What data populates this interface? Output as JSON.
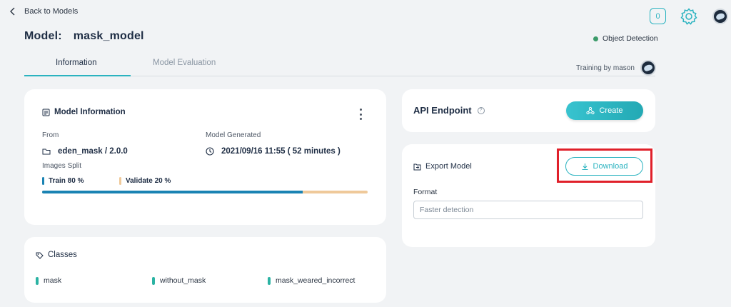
{
  "header": {
    "back_label": "Back to Models",
    "title_prefix": "Model:",
    "model_name": "mask_model",
    "notification_count": "0",
    "status_text": "Object Detection",
    "status_color": "#3c9b6a"
  },
  "tabs": [
    {
      "label": "Information",
      "active": true
    },
    {
      "label": "Model Evaluation",
      "active": false
    }
  ],
  "training_by": "Training by mason",
  "model_info": {
    "title": "Model Information",
    "from_label": "From",
    "from_value": "eden_mask / 2.0.0",
    "generated_label": "Model Generated",
    "generated_value": "2021/09/16 11:55 ( 52 minutes )",
    "split_label": "Images Split",
    "train_label": "Train 80 %",
    "validate_label": "Validate 20 %",
    "train_fraction": 0.8,
    "train_color": "#1a83b3",
    "validate_color": "#efc99a"
  },
  "classes": {
    "title": "Classes",
    "items": [
      "mask",
      "without_mask",
      "mask_weared_incorrect"
    ]
  },
  "api_endpoint": {
    "title": "API Endpoint",
    "help_glyph": "?",
    "create_label": "Create"
  },
  "export_model": {
    "title": "Export Model",
    "download_label": "Download",
    "format_label": "Format",
    "format_placeholder": "Faster detection"
  },
  "colors": {
    "accent": "#2bb3c0",
    "highlight_box": "#e0202a"
  },
  "icons": {
    "back": "chevron-left-icon",
    "settings": "gear-icon",
    "info": "document-icon",
    "from": "folder-icon",
    "generated": "clock-icon",
    "classes": "tag-icon",
    "create": "network-icon",
    "export": "export-icon",
    "download": "download-icon"
  }
}
